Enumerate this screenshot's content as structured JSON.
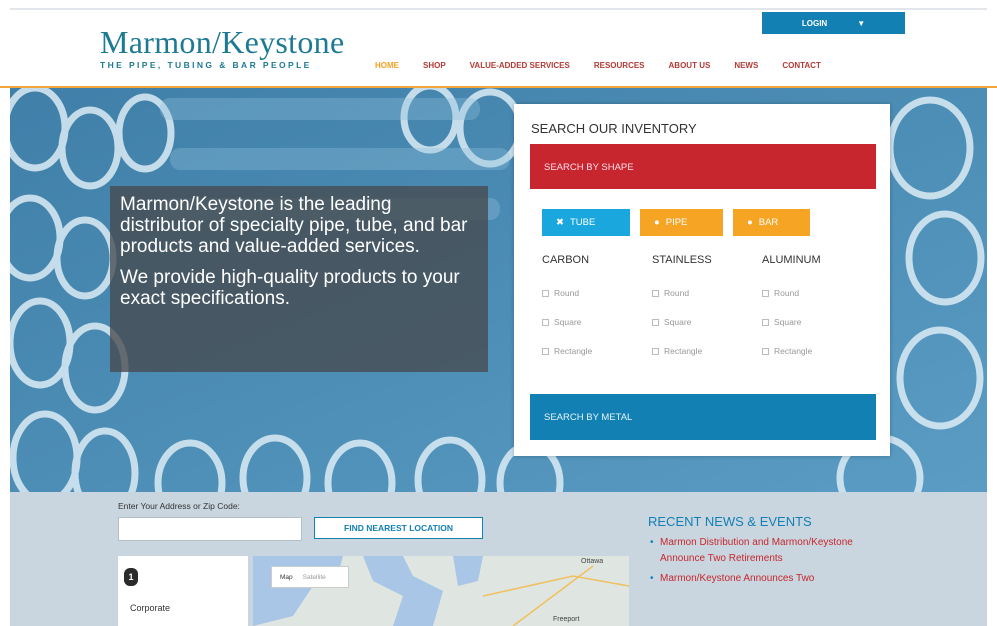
{
  "header": {
    "logo_main": "Marmon/Keystone",
    "logo_tagline": "THE PIPE, TUBING & BAR PEOPLE",
    "login_label": "LOGIN",
    "login_caret": "▼",
    "nav": [
      {
        "label": "HOME",
        "active": true
      },
      {
        "label": "SHOP"
      },
      {
        "label": "VALUE-ADDED SERVICES"
      },
      {
        "label": "RESOURCES"
      },
      {
        "label": "ABOUT US"
      },
      {
        "label": "NEWS"
      },
      {
        "label": "CONTACT"
      }
    ]
  },
  "hero": {
    "line1": "Marmon/Keystone is the leading distributor of specialty pipe, tube, and bar products and value-added services.",
    "line2": "We provide high-quality products to your exact specifications."
  },
  "search": {
    "title": "SEARCH OUR INVENTORY",
    "by_shape": "SEARCH BY SHAPE",
    "by_metal": "SEARCH BY METAL",
    "pills": [
      {
        "label": "TUBE",
        "icon": "✖"
      },
      {
        "label": "PIPE",
        "icon": "●"
      },
      {
        "label": "BAR",
        "icon": "●"
      }
    ],
    "columns": [
      {
        "heading": "CARBON",
        "options": [
          "Round",
          "Square",
          "Rectangle"
        ]
      },
      {
        "heading": "STAINLESS",
        "options": [
          "Round",
          "Square",
          "Rectangle"
        ]
      },
      {
        "heading": "ALUMINUM",
        "options": [
          "Round",
          "Square",
          "Rectangle"
        ]
      }
    ]
  },
  "locator": {
    "label": "Enter Your Address or Zip Code:",
    "find_button": "FIND NEAREST LOCATION",
    "card_number": "1",
    "card_name": "Corporate",
    "map_mode": "Map",
    "map_satellite": "Satellite",
    "city_top": "Ottawa",
    "city_bottom": "Freeport"
  },
  "news": {
    "title": "RECENT NEWS & EVENTS",
    "items": [
      "Marmon Distribution and Marmon/Keystone Announce Two Retirements",
      "Marmon/Keystone Announces Two"
    ]
  },
  "colors": {
    "brand_teal": "#1e7a93",
    "nav_red": "#b33a34",
    "accent_orange": "#f4a124",
    "shape_red": "#c8262e",
    "metal_blue": "#1380b4"
  }
}
